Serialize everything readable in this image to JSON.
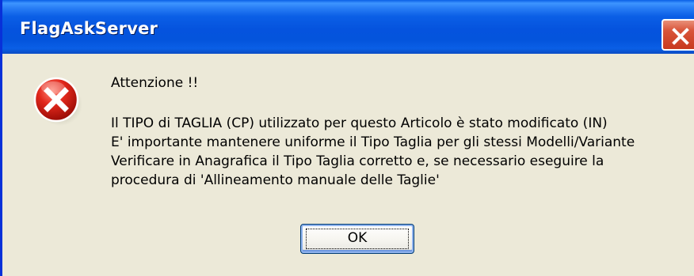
{
  "window": {
    "title": "FlagAskServer"
  },
  "dialog": {
    "icon": "error-icon",
    "heading": "Attenzione !!",
    "lines": [
      "Il TIPO di TAGLIA (CP) utilizzato per questo Articolo è stato modificato (IN)",
      "E' importante mantenere uniforme il Tipo Taglia per gli stessi Modelli/Variante",
      "Verificare in Anagrafica il Tipo Taglia corretto e, se necessario eseguire la",
      "procedura di 'Allineamento manuale delle Taglie'"
    ],
    "ok_label": "OK"
  },
  "colors": {
    "titlebar": "#0553de",
    "dialog_background": "#ece9d8",
    "close_button": "#d9553a",
    "error_red": "#d21f1f"
  }
}
